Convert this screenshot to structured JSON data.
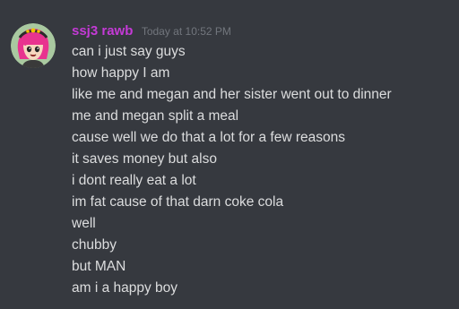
{
  "message": {
    "author": {
      "name": "ssj3 rawb",
      "color": "#c43ad6",
      "avatar_icon": "anime-girl-pink-hair-avatar"
    },
    "timestamp": "Today at 10:52 PM",
    "lines": [
      "can i just say guys",
      "how happy I am",
      "like me and megan and her sister went out to dinner",
      "me and megan split a meal",
      "cause well we do that a lot for a few reasons",
      "it saves money but also",
      "i dont really eat a lot",
      "im fat cause of that darn coke cola",
      "well",
      "chubby",
      "but MAN",
      "am i a happy boy"
    ]
  },
  "theme": {
    "background": "#36393f",
    "text": "#dcddde",
    "muted": "#72767d"
  }
}
